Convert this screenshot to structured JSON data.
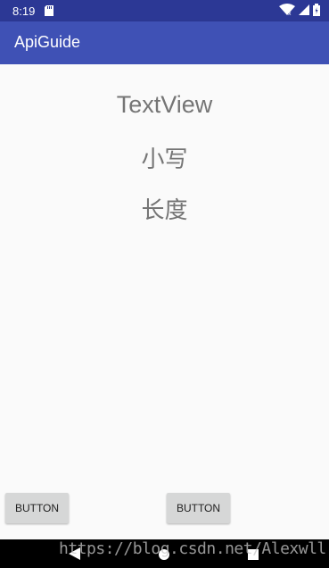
{
  "status_bar": {
    "time": "8:19",
    "icons": [
      "sd-card-icon",
      "wifi-icon",
      "signal-icon",
      "battery-icon"
    ]
  },
  "app_bar": {
    "title": "ApiGuide"
  },
  "content": {
    "text_1": "TextView",
    "text_2": "小写",
    "text_3": "长度"
  },
  "buttons": {
    "left_label": "BUTTON",
    "right_label": "BUTTON"
  },
  "nav_bar": {
    "icons": [
      "back-icon",
      "home-icon",
      "recents-icon"
    ]
  },
  "watermark": {
    "text": "https://blog.csdn.net/Alexwll"
  },
  "colors": {
    "status_bar": "#2c3895",
    "app_bar": "#3f51b5",
    "background": "#fafafa",
    "text_gray": "#757575",
    "button_bg": "#d6d7d7"
  }
}
